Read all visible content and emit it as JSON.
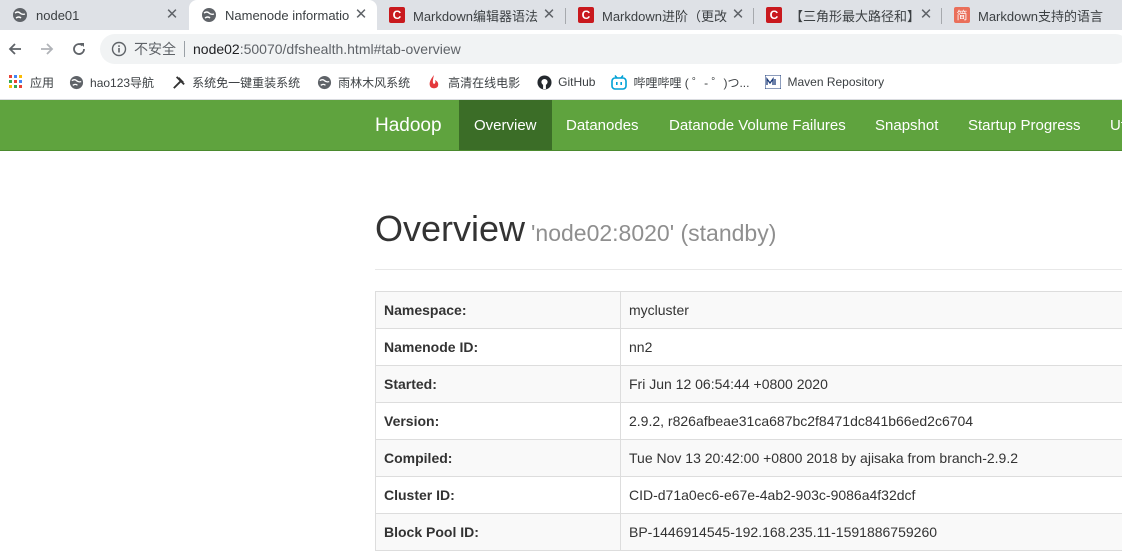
{
  "tabs": [
    {
      "title": "node01",
      "icon": "globe-icon"
    },
    {
      "title": "Namenode informatio",
      "icon": "globe-icon",
      "active": true
    },
    {
      "title": "Markdown编辑器语法",
      "icon": "csdn-c-icon"
    },
    {
      "title": "Markdown进阶（更改",
      "icon": "csdn-c-icon"
    },
    {
      "title": "【三角形最大路径和】",
      "icon": "csdn-c-icon"
    },
    {
      "title": "Markdown支持的语言",
      "icon": "jianshu-icon"
    }
  ],
  "tab_close_glyph": "✕",
  "favicon_text": {
    "csdn": "C",
    "jianshu": "简"
  },
  "address": {
    "security_label": "不安全",
    "host": "node02",
    "rest": ":50070/dfshealth.html#tab-overview"
  },
  "bookmarks": [
    {
      "label": "应用",
      "icon": "apps-grid-icon"
    },
    {
      "label": "hao123导航",
      "icon": "globe-icon"
    },
    {
      "label": "系统免一键重装系统",
      "icon": "tool-icon"
    },
    {
      "label": "雨林木风系统",
      "icon": "globe-icon"
    },
    {
      "label": "高清在线电影",
      "icon": "flame-icon"
    },
    {
      "label": "GitHub",
      "icon": "github-icon"
    },
    {
      "label": "哔哩哔哩 ( ゜- ゜)つ...",
      "icon": "bilibili-icon"
    },
    {
      "label": "Maven Repository",
      "icon": "maven-icon"
    }
  ],
  "navbar": {
    "brand": "Hadoop",
    "items": [
      "Overview",
      "Datanodes",
      "Datanode Volume Failures",
      "Snapshot",
      "Startup Progress",
      "Ut"
    ],
    "active": "Overview"
  },
  "overview": {
    "title": "Overview",
    "subtitle": "'node02:8020' (standby)"
  },
  "info_rows": [
    {
      "key": "Namespace:",
      "value": "mycluster"
    },
    {
      "key": "Namenode ID:",
      "value": "nn2"
    },
    {
      "key": "Started:",
      "value": "Fri Jun 12 06:54:44 +0800 2020"
    },
    {
      "key": "Version:",
      "value": "2.9.2, r826afbeae31ca687bc2f8471dc841b66ed2c6704"
    },
    {
      "key": "Compiled:",
      "value": "Tue Nov 13 20:42:00 +0800 2018 by ajisaka from branch-2.9.2"
    },
    {
      "key": "Cluster ID:",
      "value": "CID-d71a0ec6-e67e-4ab2-903c-9086a4f32dcf"
    },
    {
      "key": "Block Pool ID:",
      "value": "BP-1446914545-192.168.235.11-1591886759260"
    }
  ],
  "colors": {
    "navbar": "#5fa33e",
    "navbar_active": "#3b6d27",
    "csdn": "#c9191e",
    "jianshu": "#ea6f5a"
  }
}
